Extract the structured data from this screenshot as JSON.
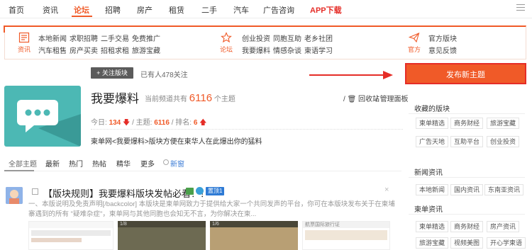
{
  "nav": {
    "items": [
      "首页",
      "资讯",
      "论坛",
      "招聘",
      "房产",
      "租赁",
      "二手",
      "汽车",
      "广告咨询",
      "APP下载"
    ],
    "active_index": 2
  },
  "categories": {
    "groups": [
      {
        "icon_label": "资讯",
        "icon": "news-icon",
        "row1": [
          "本地新闻",
          "求职招聘",
          "二手交易",
          "免费推广"
        ],
        "row2": [
          "汽车租售",
          "房产买卖",
          "招租求租",
          "旅游宝藏"
        ]
      },
      {
        "icon_label": "论坛",
        "icon": "star-icon",
        "row1": [
          "创业投资",
          "同胞互助",
          "老乡社团"
        ],
        "row2": [
          "我要爆料",
          "情感杂谈",
          "柬语学习"
        ]
      },
      {
        "icon_label": "官方",
        "icon": "paper-plane-icon",
        "row1": [
          "官方版块"
        ],
        "row2": [
          "意见反馈"
        ]
      }
    ]
  },
  "forum": {
    "follow_label": "+ 关注版块",
    "followers": "已有人478关注",
    "title": "我要爆料",
    "stat_prefix": "当前频道共有",
    "thread_count": "6116",
    "stat_suffix": "个主题",
    "favorite": "回收站",
    "admin": "管理面板",
    "today_label": "今日:",
    "today_value": "134",
    "topics_label": "主题:",
    "topics_value": "6116",
    "rank_label": "排名:",
    "rank_value": "6",
    "description": "柬单网<我要爆料>版块方便在柬华人在此爆出你的猛料"
  },
  "tabs": {
    "items": [
      "全部主题",
      "最新",
      "热门",
      "热帖",
      "精华",
      "更多"
    ],
    "new_window": "新窗"
  },
  "thread": {
    "title": "【版块规则】我要爆料版块发帖必看！！",
    "badge": "置顶1",
    "excerpt": "一、本版说明及免责声明[/backcolor] 本版块是柬单网致力于提供给大家一个共同发声的平台，你可在本版块发布关于在柬埔寨遇到的所有 \"疑难杂症\"，柬单网与其他同胞也会知无不言，为你解决在柬...",
    "thumbs": [
      "1/8",
      "1/6",
      "航票国际旅行证"
    ]
  },
  "sidebar": {
    "post_button": "发布新主题",
    "sections": [
      {
        "title": "收藏的版块",
        "chips": [
          [
            "柬单精选",
            "商务财经",
            "旅游宝藏"
          ],
          [
            "广告天地",
            "互助平台",
            "创业投资"
          ]
        ]
      },
      {
        "title": "新闻资讯",
        "chips": [
          [
            "本地新闻",
            "国内资讯",
            "东南亚资讯"
          ]
        ]
      },
      {
        "title": "柬单资讯",
        "chips": [
          [
            "柬单精选",
            "商务财经",
            "房产资讯"
          ],
          [
            "旅游宝藏",
            "视频美图",
            "开心学柬语"
          ]
        ]
      }
    ]
  },
  "colors": {
    "accent": "#f05a28",
    "forum_icon": "#4cb8b4"
  }
}
